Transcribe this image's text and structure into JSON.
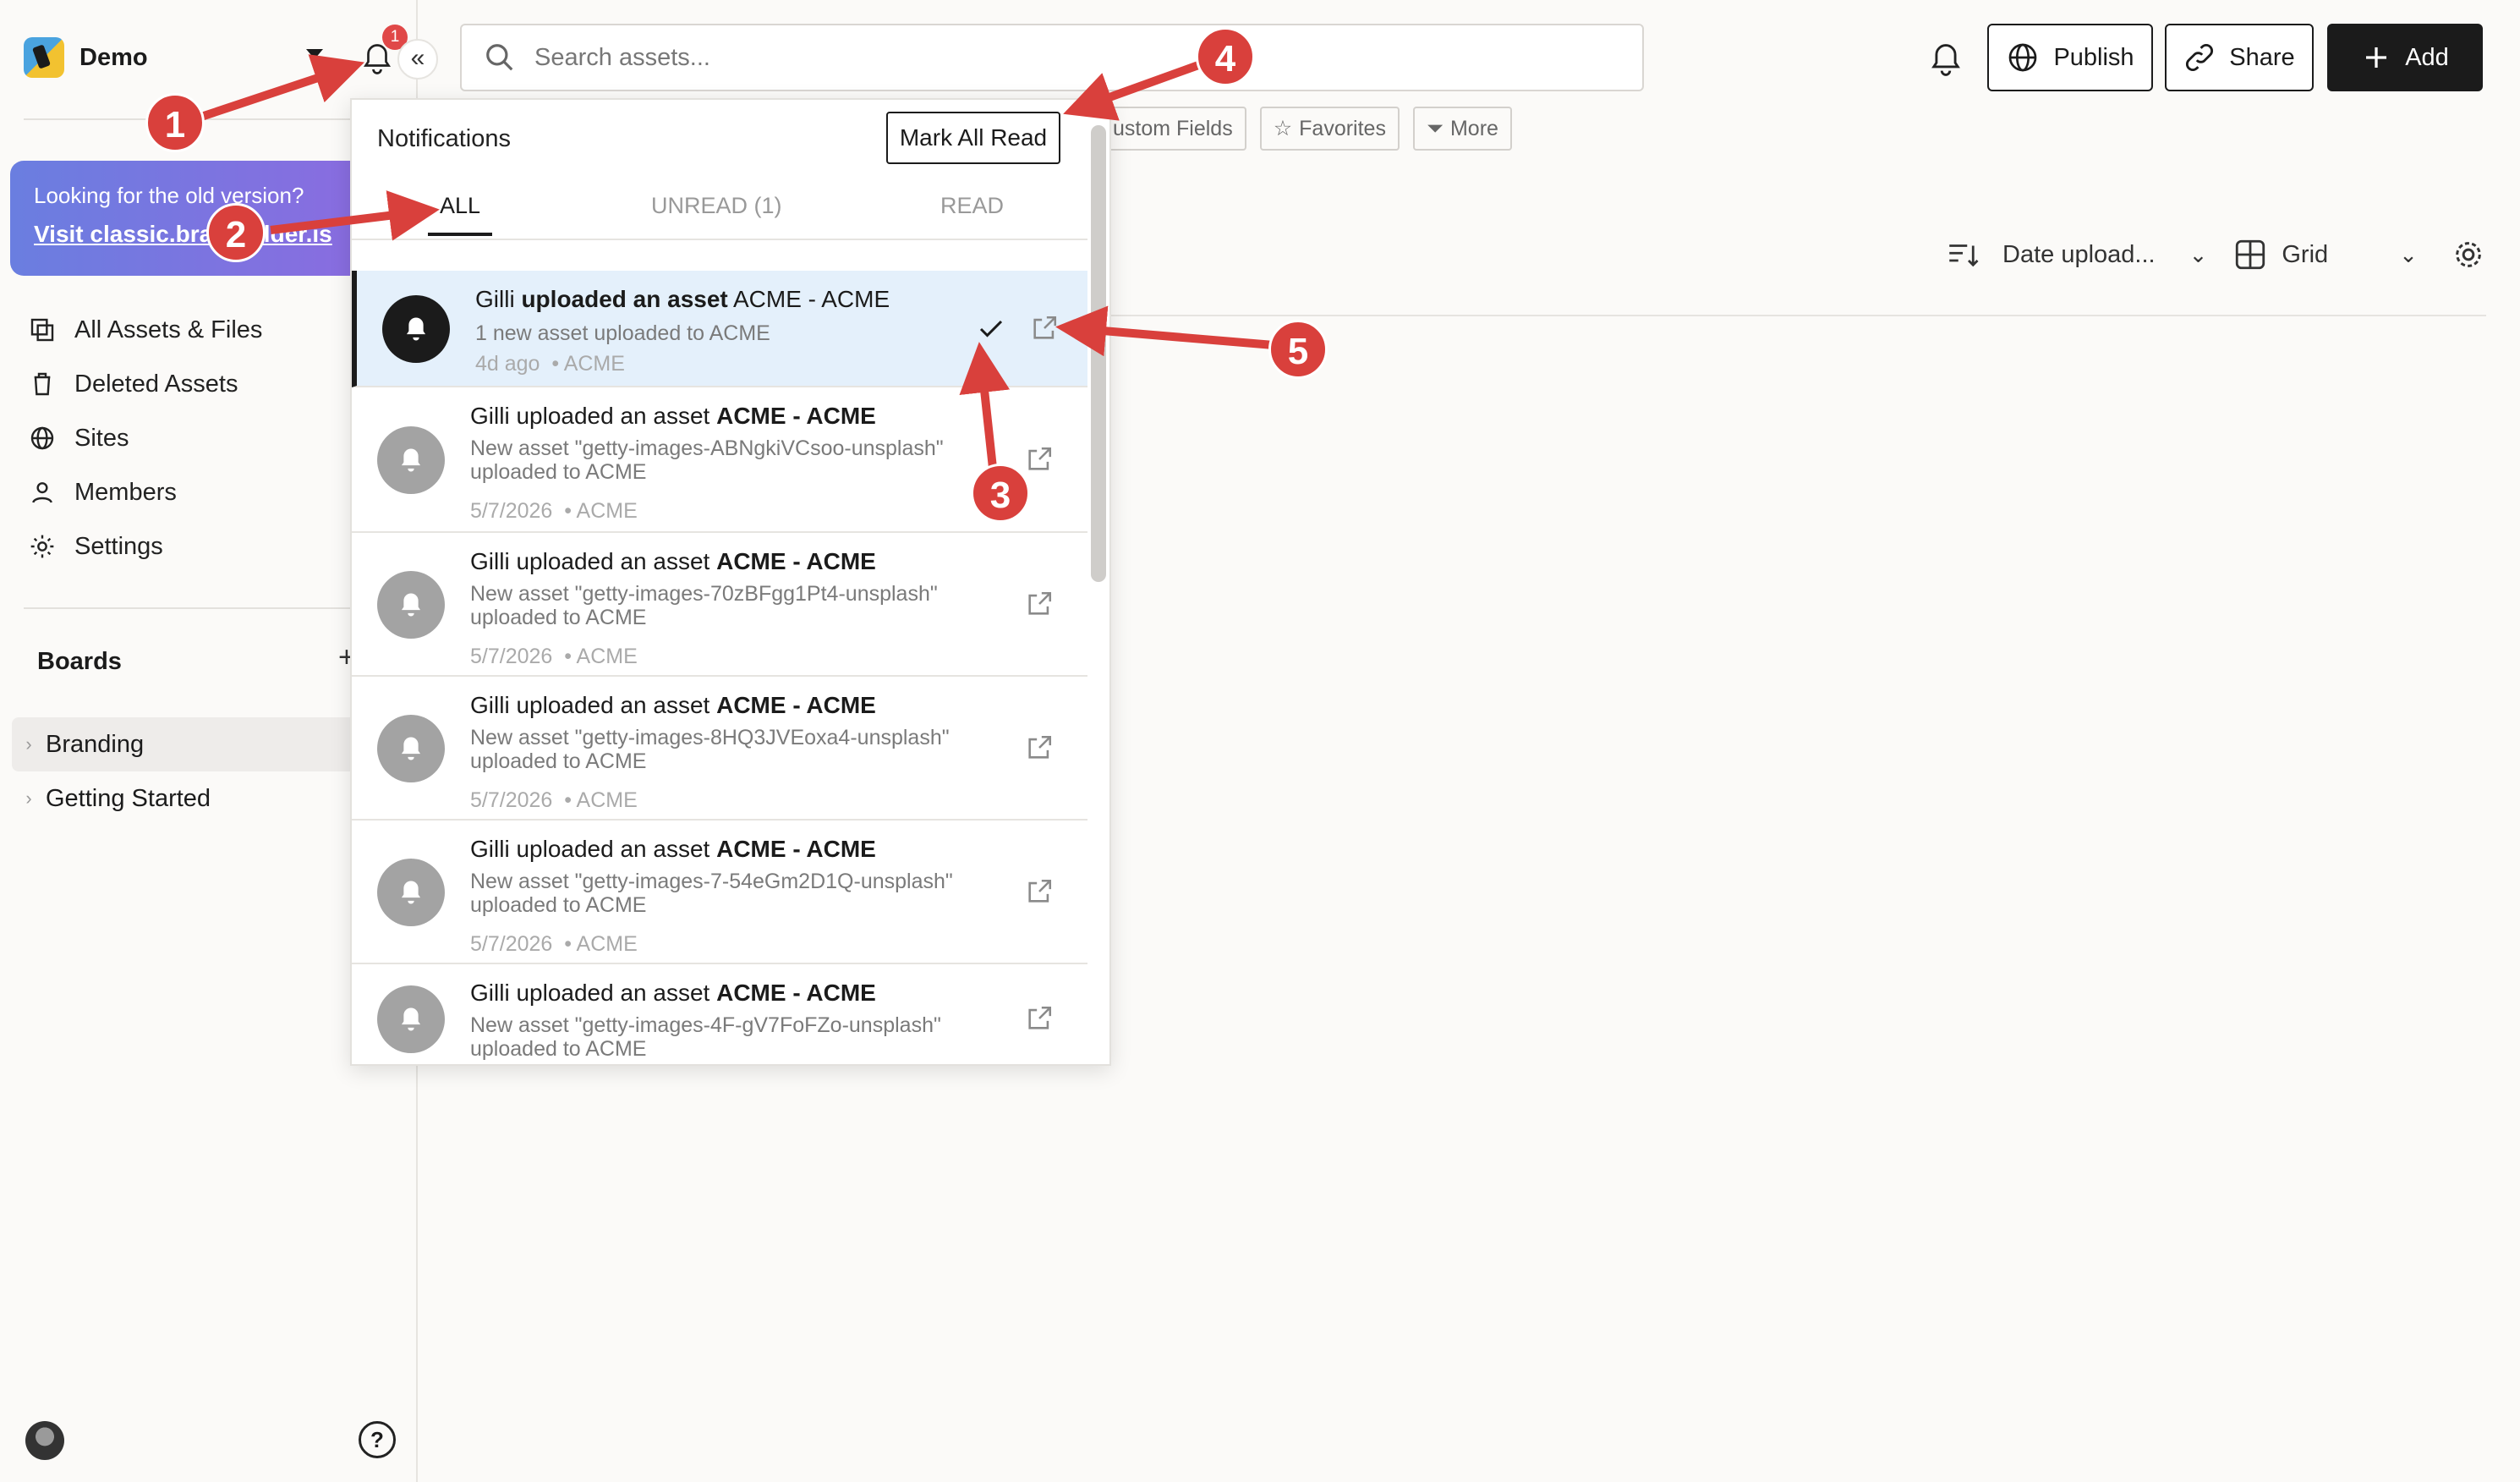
{
  "workspace": {
    "name": "Demo",
    "notif_count": "1"
  },
  "promo": {
    "line1": "Looking for the old version?",
    "line2": "Visit classic.brandfolder.is"
  },
  "nav": {
    "items": [
      {
        "label": "All Assets & Files",
        "icon": "assets-icon"
      },
      {
        "label": "Deleted Assets",
        "icon": "trash-icon"
      },
      {
        "label": "Sites",
        "icon": "globe-icon"
      },
      {
        "label": "Members",
        "icon": "user-icon"
      },
      {
        "label": "Settings",
        "icon": "gear-icon"
      }
    ]
  },
  "boards": {
    "heading": "Boards",
    "items": [
      {
        "label": "Branding"
      },
      {
        "label": "Getting Started"
      }
    ]
  },
  "search": {
    "placeholder": "Search assets..."
  },
  "toolbar": {
    "publish": "Publish",
    "share": "Share",
    "add": "Add"
  },
  "filters": [
    "ustom Fields",
    "Favorites",
    "More"
  ],
  "view": {
    "sort": "Date upload...",
    "layout": "Grid"
  },
  "notifications": {
    "title": "Notifications",
    "mark_all": "Mark All Read",
    "tabs": [
      "ALL",
      "UNREAD (1)",
      "READ"
    ],
    "items": [
      {
        "user": "Gilli",
        "action": "uploaded an asset",
        "target": "ACME - ACME",
        "desc": "1 new asset uploaded to ACME",
        "time": "4d ago",
        "source": "• ACME",
        "unread": true
      },
      {
        "user": "Gilli",
        "action": "uploaded an asset",
        "target": "ACME - ACME",
        "desc": "New asset \"getty-images-ABNgkiVCsoo-unsplash\" uploaded to ACME",
        "time": "5/7/2026",
        "source": "• ACME",
        "unread": false
      },
      {
        "user": "Gilli",
        "action": "uploaded an asset",
        "target": "ACME - ACME",
        "desc": "New asset \"getty-images-70zBFgg1Pt4-unsplash\" uploaded to ACME",
        "time": "5/7/2026",
        "source": "• ACME",
        "unread": false
      },
      {
        "user": "Gilli",
        "action": "uploaded an asset",
        "target": "ACME - ACME",
        "desc": "New asset \"getty-images-8HQ3JVEoxa4-unsplash\" uploaded to ACME",
        "time": "5/7/2026",
        "source": "• ACME",
        "unread": false
      },
      {
        "user": "Gilli",
        "action": "uploaded an asset",
        "target": "ACME - ACME",
        "desc": "New asset \"getty-images-7-54eGm2D1Q-unsplash\" uploaded to ACME",
        "time": "5/7/2026",
        "source": "• ACME",
        "unread": false
      },
      {
        "user": "Gilli",
        "action": "uploaded an asset",
        "target": "ACME - ACME",
        "desc": "New asset \"getty-images-4F-gV7FoFZo-unsplash\" uploaded to ACME",
        "time": "",
        "source": "",
        "unread": false
      }
    ]
  },
  "annotations": [
    "1",
    "2",
    "3",
    "4",
    "5"
  ],
  "colors": {
    "annotation": "#d9403c",
    "unread_bg": "#e4f0fb",
    "promo": "#7a76e0"
  }
}
